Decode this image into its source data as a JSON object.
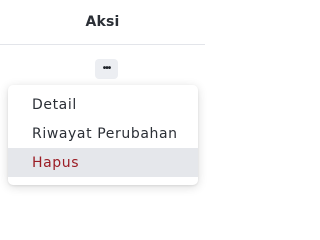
{
  "table": {
    "header": {
      "label": "Aksi"
    }
  },
  "row_actions": {
    "more_button": {
      "icon": "more-horizontal-icon",
      "glyph": "•••"
    }
  },
  "dropdown": {
    "items": [
      {
        "label": "Detail"
      },
      {
        "label": "Riwayat Perubahan"
      },
      {
        "label": "Hapus",
        "highlighted": true,
        "color": "#9b1c24"
      }
    ]
  }
}
